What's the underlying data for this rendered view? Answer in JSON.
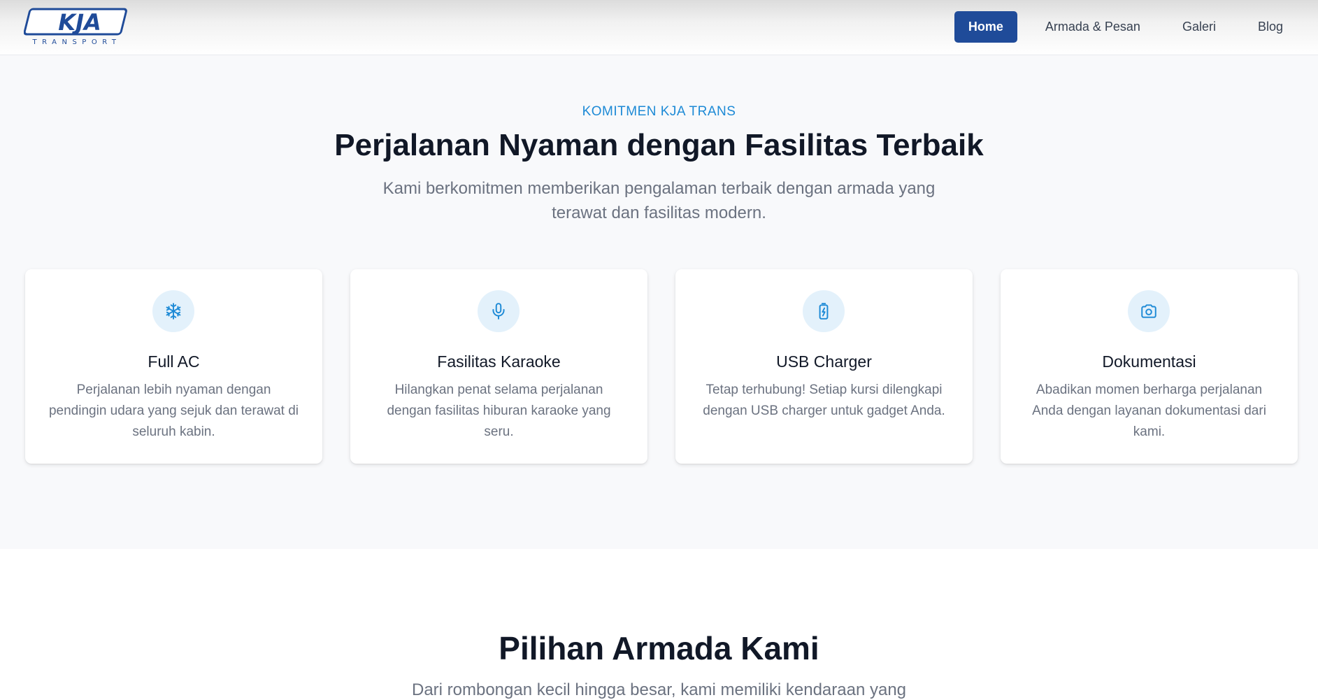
{
  "brand": {
    "logo_text": "KJA",
    "logo_subtext": "TRANSPORT",
    "logo_color": "#1f4b99"
  },
  "nav": {
    "items": [
      {
        "label": "Home",
        "active": true
      },
      {
        "label": "Armada & Pesan",
        "active": false
      },
      {
        "label": "Galeri",
        "active": false
      },
      {
        "label": "Blog",
        "active": false
      }
    ]
  },
  "features": {
    "eyebrow": "KOMITMEN KJA TRANS",
    "title": "Perjalanan Nyaman dengan Fasilitas Terbaik",
    "subtitle": "Kami berkomitmen memberikan pengalaman terbaik dengan armada yang terawat dan fasilitas modern.",
    "accent_color": "#1d8ad6",
    "cards": [
      {
        "icon": "snowflake-icon",
        "title": "Full AC",
        "description": "Perjalanan lebih nyaman dengan pendingin udara yang sejuk dan terawat di seluruh kabin."
      },
      {
        "icon": "microphone-icon",
        "title": "Fasilitas Karaoke",
        "description": "Hilangkan penat selama perjalanan dengan fasilitas hiburan karaoke yang seru."
      },
      {
        "icon": "battery-charging-icon",
        "title": "USB Charger",
        "description": "Tetap terhubung! Setiap kursi dilengkapi dengan USB charger untuk gadget Anda."
      },
      {
        "icon": "camera-icon",
        "title": "Dokumentasi",
        "description": "Abadikan momen berharga perjalanan Anda dengan layanan dokumentasi dari kami."
      }
    ]
  },
  "fleet": {
    "title": "Pilihan Armada Kami",
    "subtitle": "Dari rombongan kecil hingga besar, kami memiliki kendaraan yang"
  }
}
